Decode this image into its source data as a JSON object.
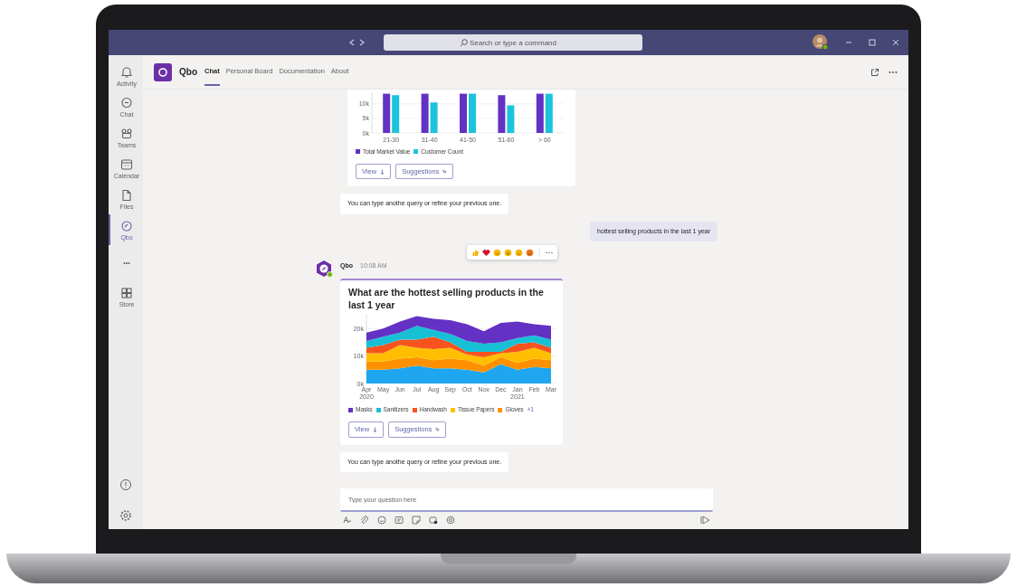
{
  "title_bar": {
    "search": {
      "placeholder": "Search or type a command"
    }
  },
  "app_rail": {
    "items": [
      {
        "kind": "bell",
        "label": "Activity",
        "selected": false
      },
      {
        "kind": "chat",
        "label": "Chat",
        "selected": false
      },
      {
        "kind": "teams",
        "label": "Teams",
        "selected": false
      },
      {
        "kind": "calendar",
        "label": "Calendar",
        "selected": false
      },
      {
        "kind": "files",
        "label": "Files",
        "selected": false
      },
      {
        "kind": "app",
        "label": "Qbo",
        "selected": true
      },
      {
        "kind": "more",
        "label": "•••",
        "selected": false
      },
      {
        "kind": "store",
        "label": "Store",
        "selected": false
      }
    ]
  },
  "app_header": {
    "name": "Qbo",
    "tabs": [
      {
        "label": "Chat",
        "selected": true
      },
      {
        "label": "Personal Board",
        "selected": false
      },
      {
        "label": "Documentation",
        "selected": false
      },
      {
        "label": "About",
        "selected": false
      }
    ]
  },
  "messages": [
    {
      "kind": "card",
      "chart_data": {
        "type": "bar",
        "categories": [
          "21-30",
          "31-40",
          "41-50",
          "51-60",
          "> 60"
        ],
        "ylim": [
          0,
          14
        ],
        "yticks": [
          {
            "value": 0,
            "label": "0k"
          },
          {
            "value": 5,
            "label": "5k"
          },
          {
            "value": 10,
            "label": "10k"
          }
        ],
        "series": [
          {
            "name": "Total Market Value",
            "color": "#6331c4",
            "values": [
              13.5,
              13.5,
              13.5,
              13,
              13.5
            ]
          },
          {
            "name": "Customer Count",
            "color": "#1cc3dc",
            "values": [
              13,
              10.5,
              13.5,
              9.5,
              13.5
            ]
          }
        ]
      },
      "buttons": [
        {
          "label": "View"
        },
        {
          "label": "Suggestions"
        }
      ]
    },
    {
      "kind": "bot_text",
      "text": "You can type anothe query or refine your previous one."
    },
    {
      "kind": "user_text",
      "text": "hottest selling products in the last 1 year"
    },
    {
      "kind": "bot_card",
      "sender": "Qbo",
      "time": "10:08 AM",
      "title": "What are the hottest selling products in the last 1 year",
      "chart_data": {
        "type": "area",
        "stacked": true,
        "categories": [
          [
            "Apr",
            "2020"
          ],
          [
            "May"
          ],
          [
            "Jun"
          ],
          [
            "Jul"
          ],
          [
            "Aug"
          ],
          [
            "Sep"
          ],
          [
            "Oct"
          ],
          [
            "Nov"
          ],
          [
            "Dec"
          ],
          [
            "Jan",
            "2021"
          ],
          [
            "Feb"
          ],
          [
            "Mar"
          ]
        ],
        "ylim": [
          0,
          25
        ],
        "yticks": [
          {
            "value": 0,
            "label": "0k"
          },
          {
            "value": 10,
            "label": "10k"
          },
          {
            "value": 20,
            "label": "20k"
          }
        ],
        "series": [
          {
            "name": "Masks",
            "color": "#6331c4",
            "values": [
              3,
              3,
              4,
              3.5,
              4,
              5,
              6,
              4.5,
              7,
              6,
              4,
              5
            ]
          },
          {
            "name": "Sanitizers",
            "color": "#18c0d6",
            "values": [
              2.5,
              3,
              2.5,
              5,
              2.5,
              3,
              4,
              3,
              3.5,
              2,
              2.5,
              3
            ]
          },
          {
            "name": "Handwash",
            "color": "#f8531e",
            "values": [
              2,
              3,
              2,
              3,
              4.5,
              2,
              1,
              2,
              0.5,
              3,
              2,
              2
            ]
          },
          {
            "name": "Tissue Papers",
            "color": "#ffbf00",
            "values": [
              3,
              3,
              5,
              3.5,
              4,
              4,
              2,
              3,
              1.5,
              4,
              4,
              2.5
            ]
          },
          {
            "name": "Gloves",
            "color": "#ff9100",
            "values": [
              3,
              3,
              3.5,
              3,
              3,
              3.5,
              3.5,
              2.5,
              2.5,
              2.5,
              3,
              3
            ]
          },
          {
            "name": null,
            "color": "#1ea7f0",
            "values": [
              5,
              5,
              5.5,
              6.5,
              5.5,
              5.5,
              5,
              4,
              7,
              5,
              6,
              5.5
            ]
          }
        ]
      },
      "legend_more": "+1",
      "buttons": [
        {
          "label": "View"
        },
        {
          "label": "Suggestions"
        }
      ]
    },
    {
      "kind": "bot_text",
      "text": "You can type anothe query or refine your previous one."
    }
  ],
  "compose": {
    "placeholder": "Type your question here"
  }
}
